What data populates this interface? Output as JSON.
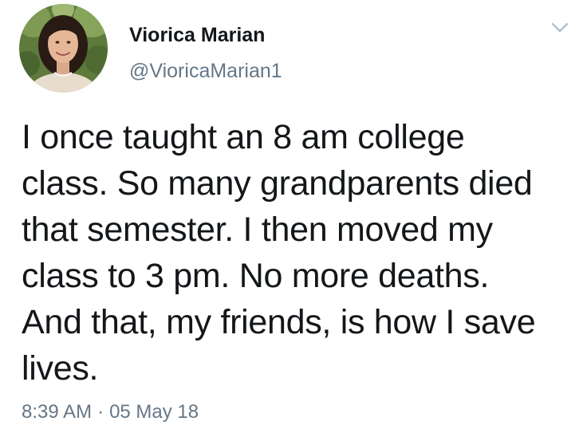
{
  "author": {
    "display_name": "Viorica Marian",
    "handle": "@VioricaMarian1"
  },
  "tweet": {
    "lines": [
      "I once taught an 8 am college",
      "class. So many grandparents died",
      "that semester. I then moved my",
      "class to 3 pm. No more deaths.",
      "And that, my friends, is how I save",
      "lives."
    ],
    "time": "8:39 AM",
    "separator": "·",
    "date": "05 May 18"
  },
  "icons": {
    "menu": "chevron-down-icon",
    "avatar": "profile-photo"
  },
  "colors": {
    "text": "#14171a",
    "secondary": "#657786",
    "background": "#ffffff"
  }
}
